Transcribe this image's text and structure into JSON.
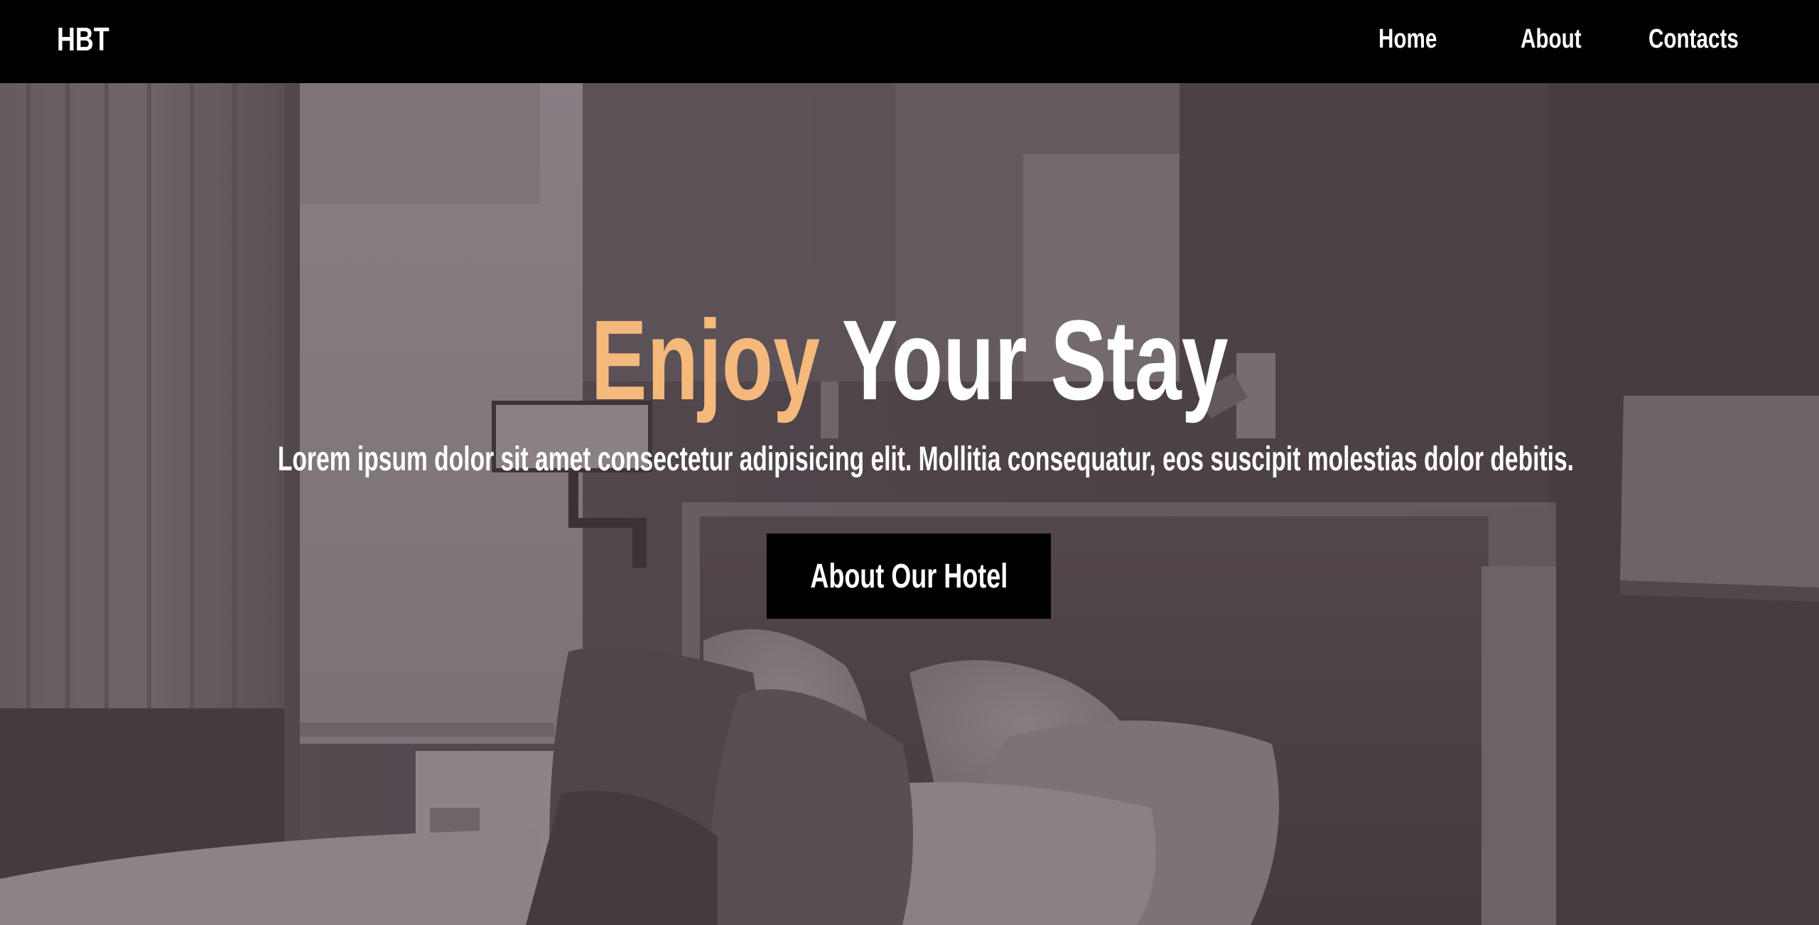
{
  "navbar": {
    "brand": "HBT",
    "links": [
      {
        "label": "Home"
      },
      {
        "label": "About"
      },
      {
        "label": "Contacts"
      }
    ]
  },
  "hero": {
    "title_accent": "Enjoy",
    "title_rest": "Your Stay",
    "subtitle": "Lorem ipsum dolor sit amet consectetur adipisicing elit. Mollitia consequatur, eos suscipit molestias dolor debitis.",
    "cta_label": "About Our Hotel",
    "background_image": "hotel-room-photo"
  },
  "colors": {
    "navbar_bg": "#000000",
    "accent": "#f6b97c",
    "text": "#ffffff",
    "button_bg": "#000000"
  }
}
